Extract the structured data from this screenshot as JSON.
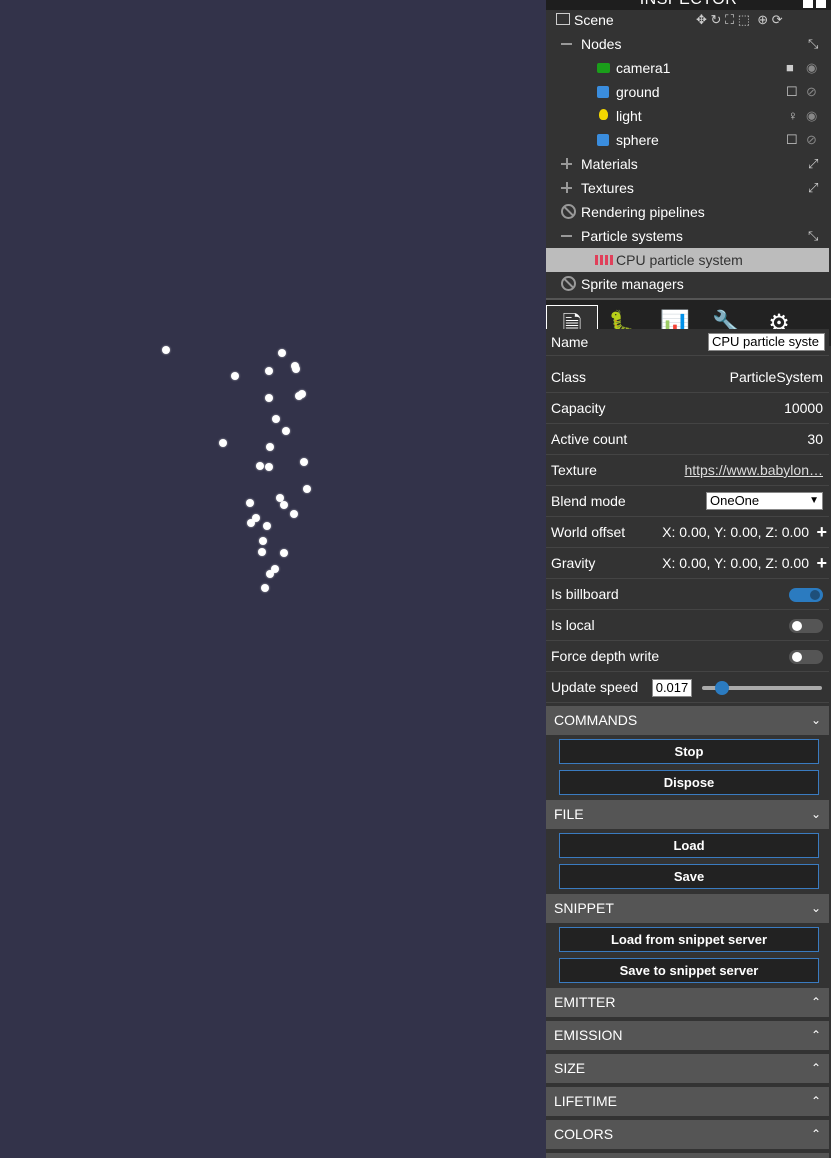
{
  "inspector": {
    "title": "INSPECTOR"
  },
  "tree": {
    "scene_label": "Scene",
    "nodes_label": "Nodes",
    "nodes": [
      {
        "label": "camera1",
        "icon": "camera-icon"
      },
      {
        "label": "ground",
        "icon": "mesh-icon"
      },
      {
        "label": "light",
        "icon": "light-icon"
      },
      {
        "label": "sphere",
        "icon": "mesh-icon"
      }
    ],
    "materials_label": "Materials",
    "textures_label": "Textures",
    "rendering_pipelines_label": "Rendering pipelines",
    "particle_systems_label": "Particle systems",
    "cpu_particle_label": "CPU particle system",
    "sprite_managers_label": "Sprite managers"
  },
  "tabs": [
    "properties-icon",
    "debug-icon",
    "statistics-icon",
    "tools-icon",
    "settings-icon"
  ],
  "props": {
    "name_label": "Name",
    "name_value": "CPU particle syste",
    "class_label": "Class",
    "class_value": "ParticleSystem",
    "capacity_label": "Capacity",
    "capacity_value": "10000",
    "active_label": "Active count",
    "active_value": "30",
    "texture_label": "Texture",
    "texture_value": "https://www.babylon…",
    "blend_label": "Blend mode",
    "blend_value": "OneOne",
    "world_offset_label": "World offset",
    "world_offset_value": "X: 0.00, Y: 0.00, Z: 0.00",
    "gravity_label": "Gravity",
    "gravity_value": "X: 0.00, Y: 0.00, Z: 0.00",
    "billboard_label": "Is billboard",
    "billboard_on": true,
    "local_label": "Is local",
    "local_on": false,
    "depth_label": "Force depth write",
    "depth_on": false,
    "update_label": "Update speed",
    "update_value": "0.017",
    "update_slider_fraction": 0.17
  },
  "sections": {
    "commands": "COMMANDS",
    "stop": "Stop",
    "dispose": "Dispose",
    "file": "FILE",
    "load": "Load",
    "save": "Save",
    "snippet": "SNIPPET",
    "load_snippet": "Load from snippet server",
    "save_snippet": "Save to snippet server",
    "emitter": "EMITTER",
    "emission": "EMISSION",
    "size": "SIZE",
    "lifetime": "LIFETIME",
    "colors": "COLORS"
  },
  "colors": {
    "viewport_bg": "#33334a",
    "panel_bg": "#333333",
    "accent": "#2b7bc0"
  }
}
